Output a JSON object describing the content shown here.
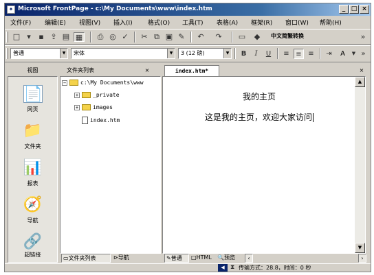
{
  "title": "Microsoft FrontPage - c:\\My Documents\\www\\index.htm",
  "window_buttons": [
    "_",
    "□",
    "×"
  ],
  "menu": [
    "文件(F)",
    "编辑(E)",
    "视图(V)",
    "插入(I)",
    "格式(O)",
    "工具(T)",
    "表格(A)",
    "框架(R)",
    "窗口(W)",
    "帮助(H)"
  ],
  "toolbar": {
    "convert_label": "中文简繁转换"
  },
  "format_bar": {
    "style_value": "普通",
    "font_value": "宋体",
    "size_value": "3 (12 磅)",
    "bold": "B",
    "italic": "I",
    "underline": "U"
  },
  "panel_tabs": {
    "views": "视图",
    "folder_list": "文件夹列表",
    "close": "×",
    "doc_tab": "index.htm*",
    "doc_close": "×"
  },
  "views": [
    {
      "label": "网页",
      "icon": "page-view-icon",
      "glyph": "📄"
    },
    {
      "label": "文件夹",
      "icon": "folder-view-icon",
      "glyph": "📁"
    },
    {
      "label": "报表",
      "icon": "reports-view-icon",
      "glyph": "📊"
    },
    {
      "label": "导航",
      "icon": "navigation-view-icon",
      "glyph": "🧭"
    },
    {
      "label": "超链接",
      "icon": "hyperlinks-view-icon",
      "glyph": "🔗"
    }
  ],
  "folder_tree": {
    "root": "c:\\My Documents\\www",
    "items": [
      "_private",
      "images",
      "index.htm"
    ]
  },
  "document": {
    "heading": "我的主页",
    "body": "这是我的主页，欢迎大家访问"
  },
  "bottom_tabs": {
    "folder_list": "文件夹列表",
    "navigation": "导航",
    "normal": "普通",
    "html": "HTML",
    "preview": "预览"
  },
  "status": {
    "transfer": "传输方式：28.8，时间：0 秒"
  },
  "colors": {
    "title_start": "#0a246a",
    "title_end": "#a6caf0",
    "chrome": "#d4d0c8"
  }
}
